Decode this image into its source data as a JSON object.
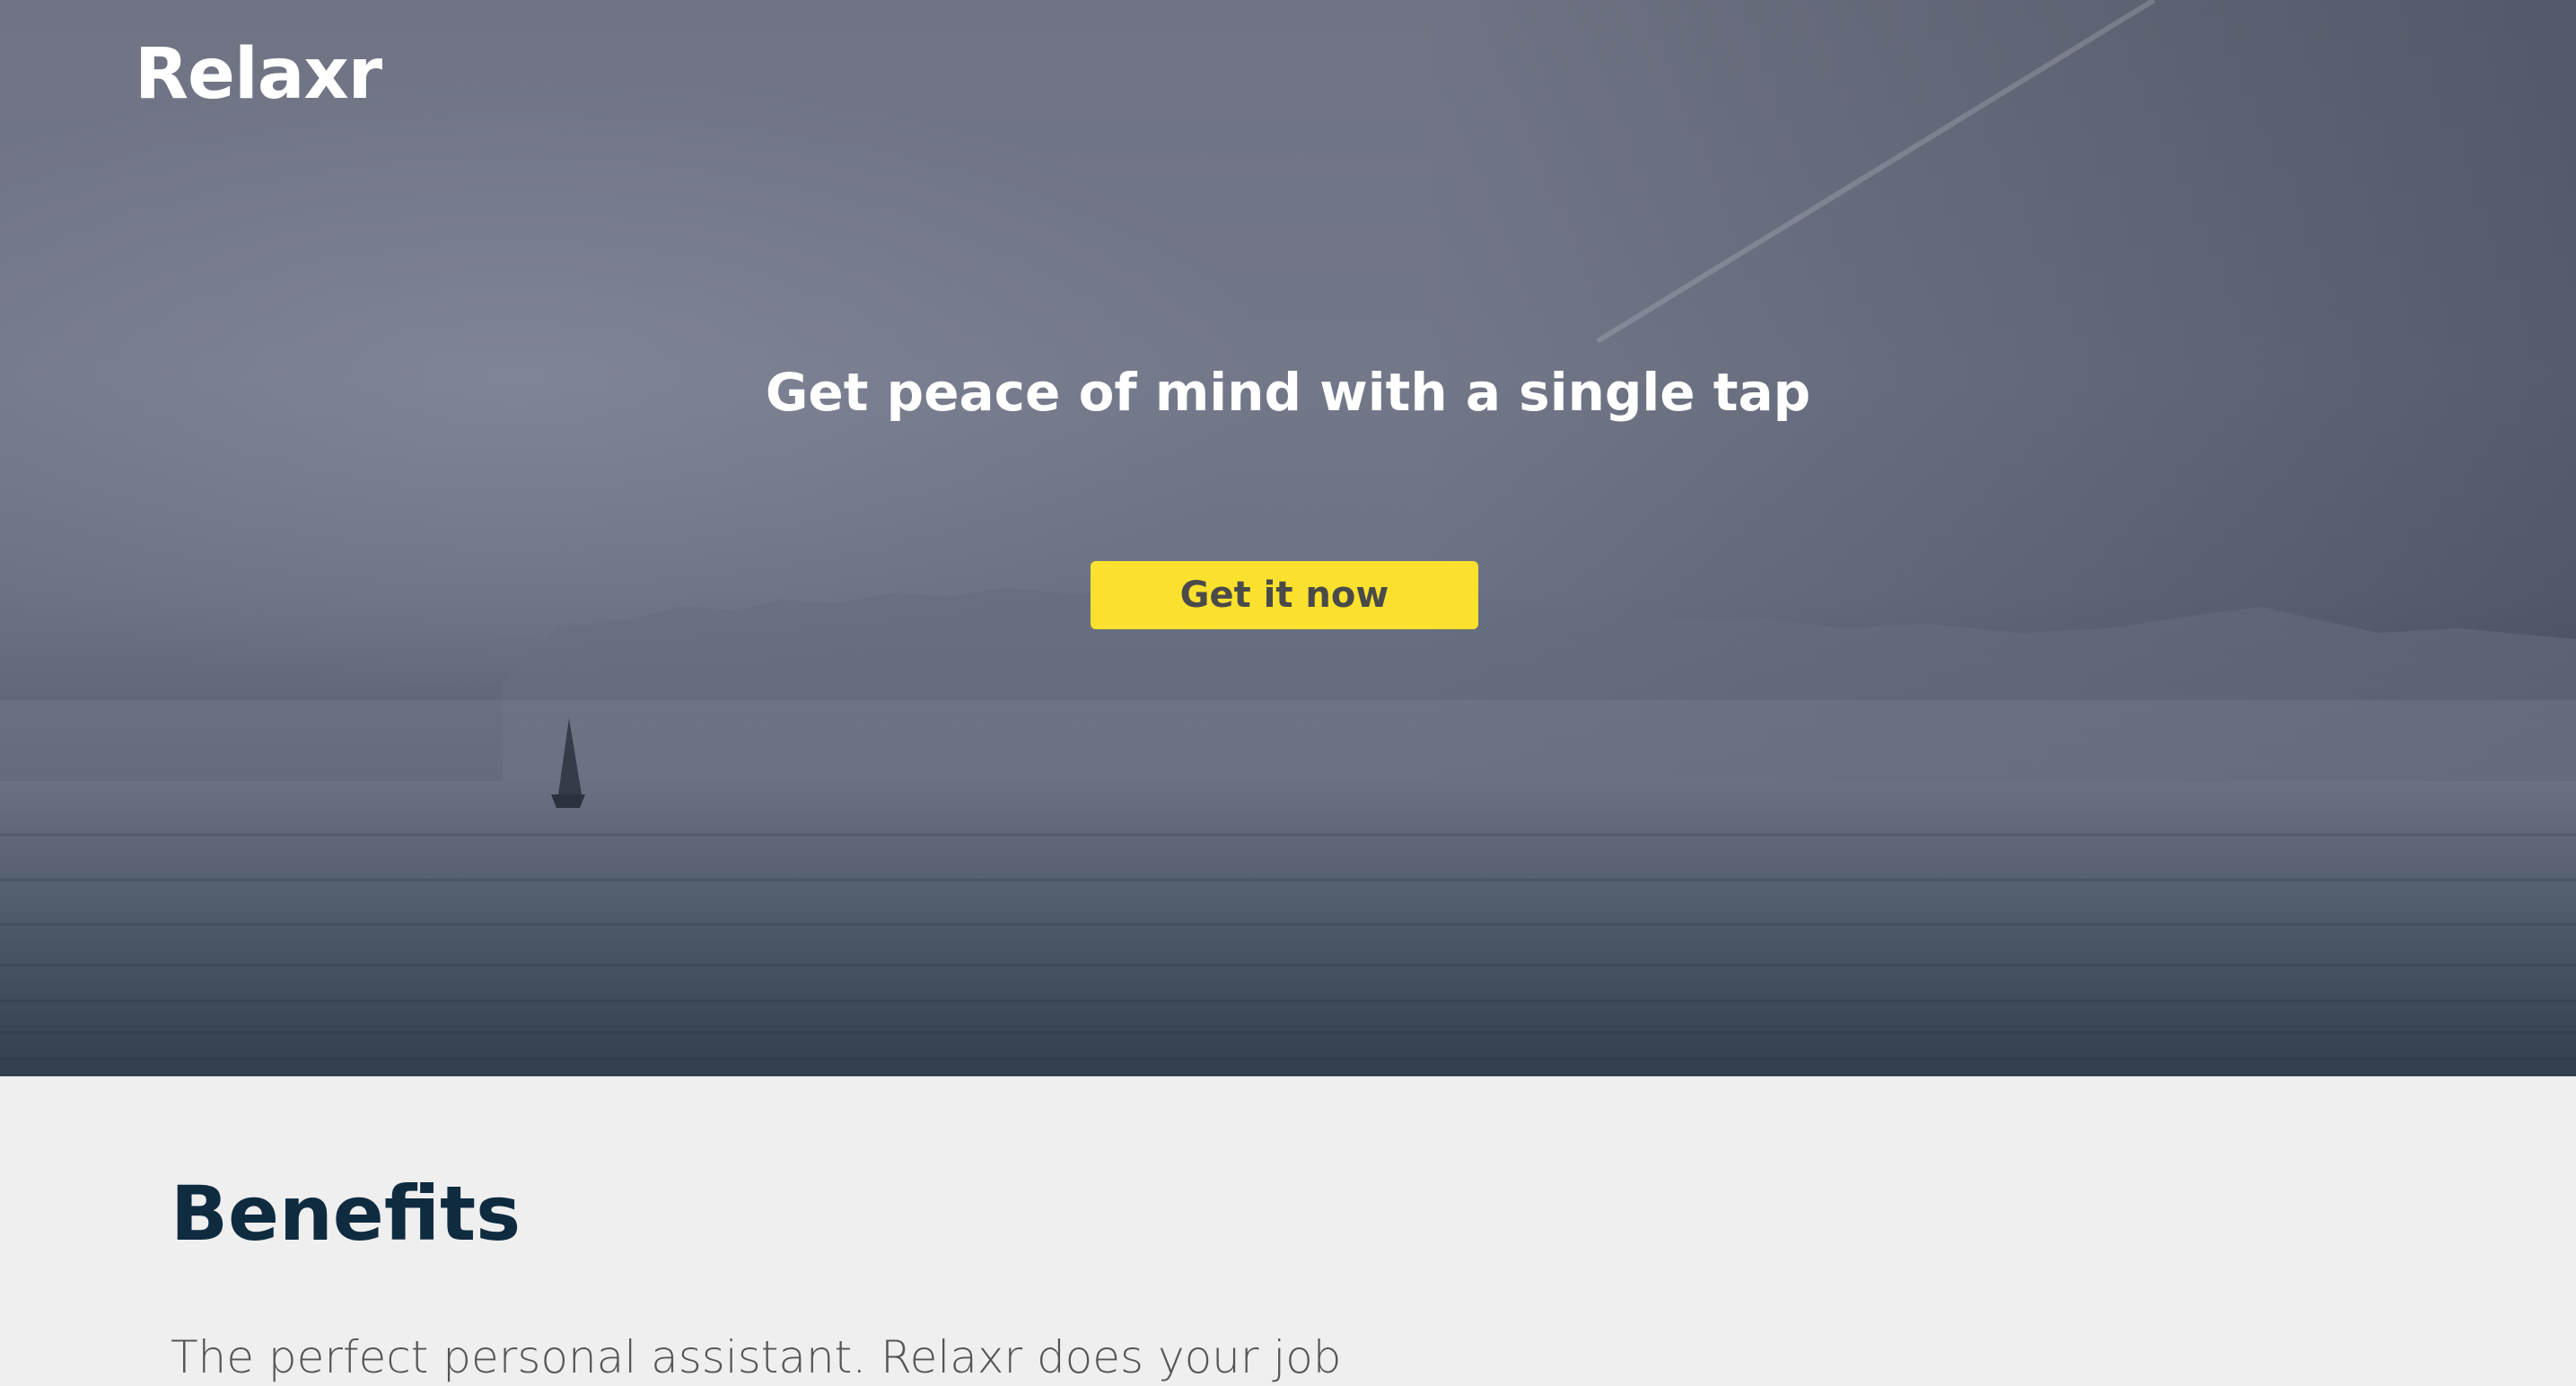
{
  "header": {
    "logo": "Relaxr"
  },
  "hero": {
    "tagline": "Get peace of mind with a single tap",
    "cta_label": "Get it now",
    "cta_color": "#f9e12e"
  },
  "benefits": {
    "title": "Benefits",
    "text": "The perfect personal assistant. Relaxr does your job"
  },
  "colors": {
    "heading": "#0f2b40",
    "section_background": "#efefef"
  }
}
